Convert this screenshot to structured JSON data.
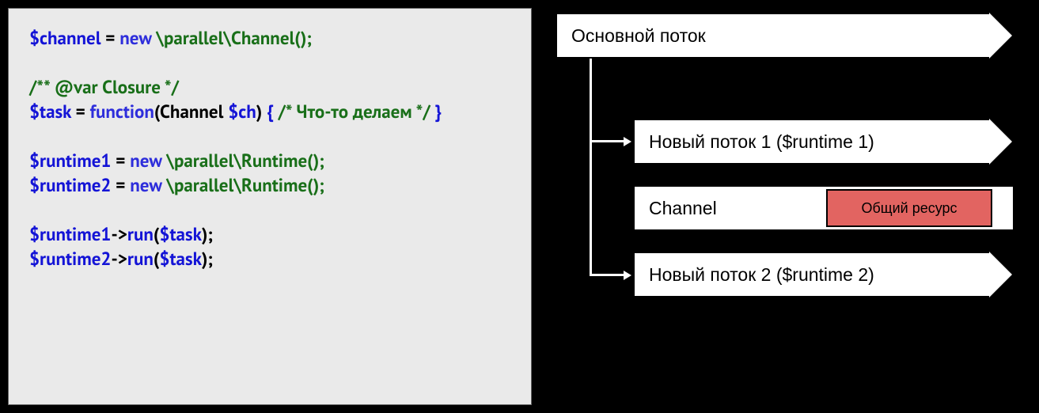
{
  "code": {
    "l1_var": "$channel",
    "l1_eq": " = ",
    "l1_new": "new",
    "l1_ns": " \\parallel\\Channel",
    "l1_p": "();",
    "l2_cm": "/** @var Closure */",
    "l3_var": "$task",
    "l3_eq": " = ",
    "l3_fn": "function",
    "l3_sig1": "(Channel ",
    "l3_sig_var": "$ch",
    "l3_sig2": ")",
    "l3_brace": " {",
    "l3_cm": " /* Что-то делаем */ ",
    "l3_brace2": "}",
    "l5_var": "$runtime1",
    "l5_eq": " = ",
    "l5_new": "new",
    "l5_ns": " \\parallel\\Runtime",
    "l5_p": "();",
    "l6_var": "$runtime2",
    "l6_eq": " = ",
    "l6_new": "new",
    "l6_ns": " \\parallel\\Runtime",
    "l6_p": "();",
    "l8_var": "$runtime1",
    "l8_arrow": "->",
    "l8_call": "run",
    "l8_p1": "(",
    "l8_arg": "$task",
    "l8_p2": ");",
    "l9_var": "$runtime2",
    "l9_arrow": "->",
    "l9_call": "run",
    "l9_p1": "(",
    "l9_arg": "$task",
    "l9_p2": ");"
  },
  "diagram": {
    "main_thread": "Основной поток",
    "thread1": "Новый поток 1 ($runtime 1)",
    "channel": "Channel",
    "shared_resource": "Общий ресурс",
    "thread2": "Новый поток 2 ($runtime 2)"
  }
}
